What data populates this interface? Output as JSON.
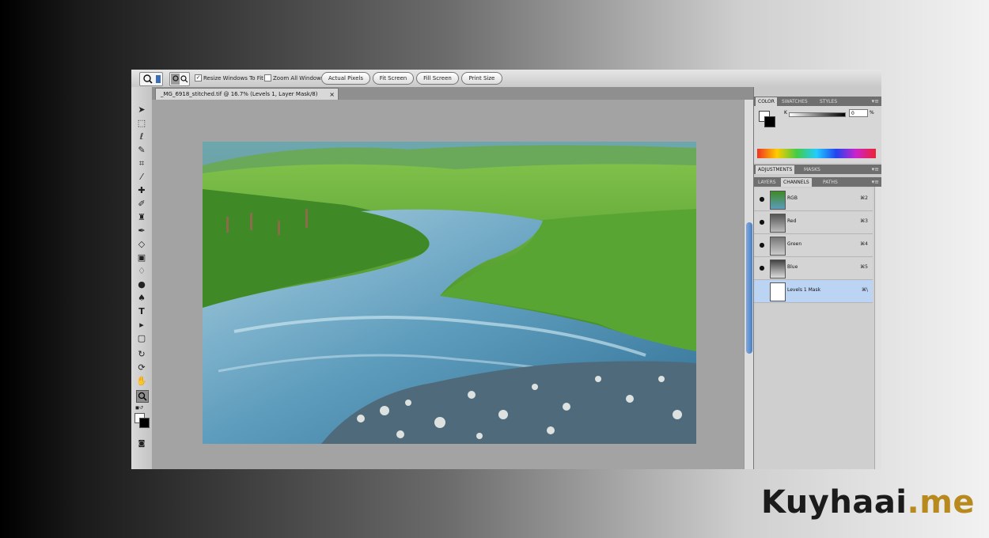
{
  "options_bar": {
    "resize_windows_label": "Resize Windows To Fit",
    "zoom_all_label": "Zoom All Windows",
    "buttons": [
      "Actual Pixels",
      "Fit Screen",
      "Fill Screen",
      "Print Size"
    ]
  },
  "document": {
    "tab_title": "_MG_6918_stitched.tif @ 16.7% (Levels 1, Layer Mask/8)",
    "close_glyph": "×"
  },
  "toolbox": {
    "icons": [
      "move-icon",
      "marquee-icon",
      "lasso-icon",
      "quick-select-icon",
      "crop-icon",
      "eyedropper-icon",
      "healing-icon",
      "brush-icon",
      "clone-stamp-icon",
      "history-brush-icon",
      "eraser-icon",
      "gradient-icon",
      "blur-icon",
      "dodge-icon",
      "pen-icon",
      "type-icon",
      "path-select-icon",
      "shape-icon",
      "3d-rotate-icon",
      "3d-orbit-icon",
      "hand-icon",
      "zoom-icon"
    ]
  },
  "panels": {
    "color_tabs": [
      "COLOR",
      "SWATCHES",
      "STYLES"
    ],
    "color_channel": "K",
    "color_value": "0",
    "color_unit": "%",
    "adjust_tabs": [
      "ADJUSTMENTS",
      "MASKS"
    ],
    "layer_tabs": [
      "LAYERS",
      "CHANNELS",
      "PATHS"
    ],
    "menu_glyph": "▾≡",
    "channels": [
      {
        "name": "RGB",
        "key": "⌘2"
      },
      {
        "name": "Red",
        "key": "⌘3"
      },
      {
        "name": "Green",
        "key": "⌘4"
      },
      {
        "name": "Blue",
        "key": "⌘5"
      },
      {
        "name": "Levels 1 Mask",
        "key": "⌘\\"
      }
    ]
  },
  "watermark": {
    "name": "Kuyhaai",
    "tld": ".me"
  }
}
